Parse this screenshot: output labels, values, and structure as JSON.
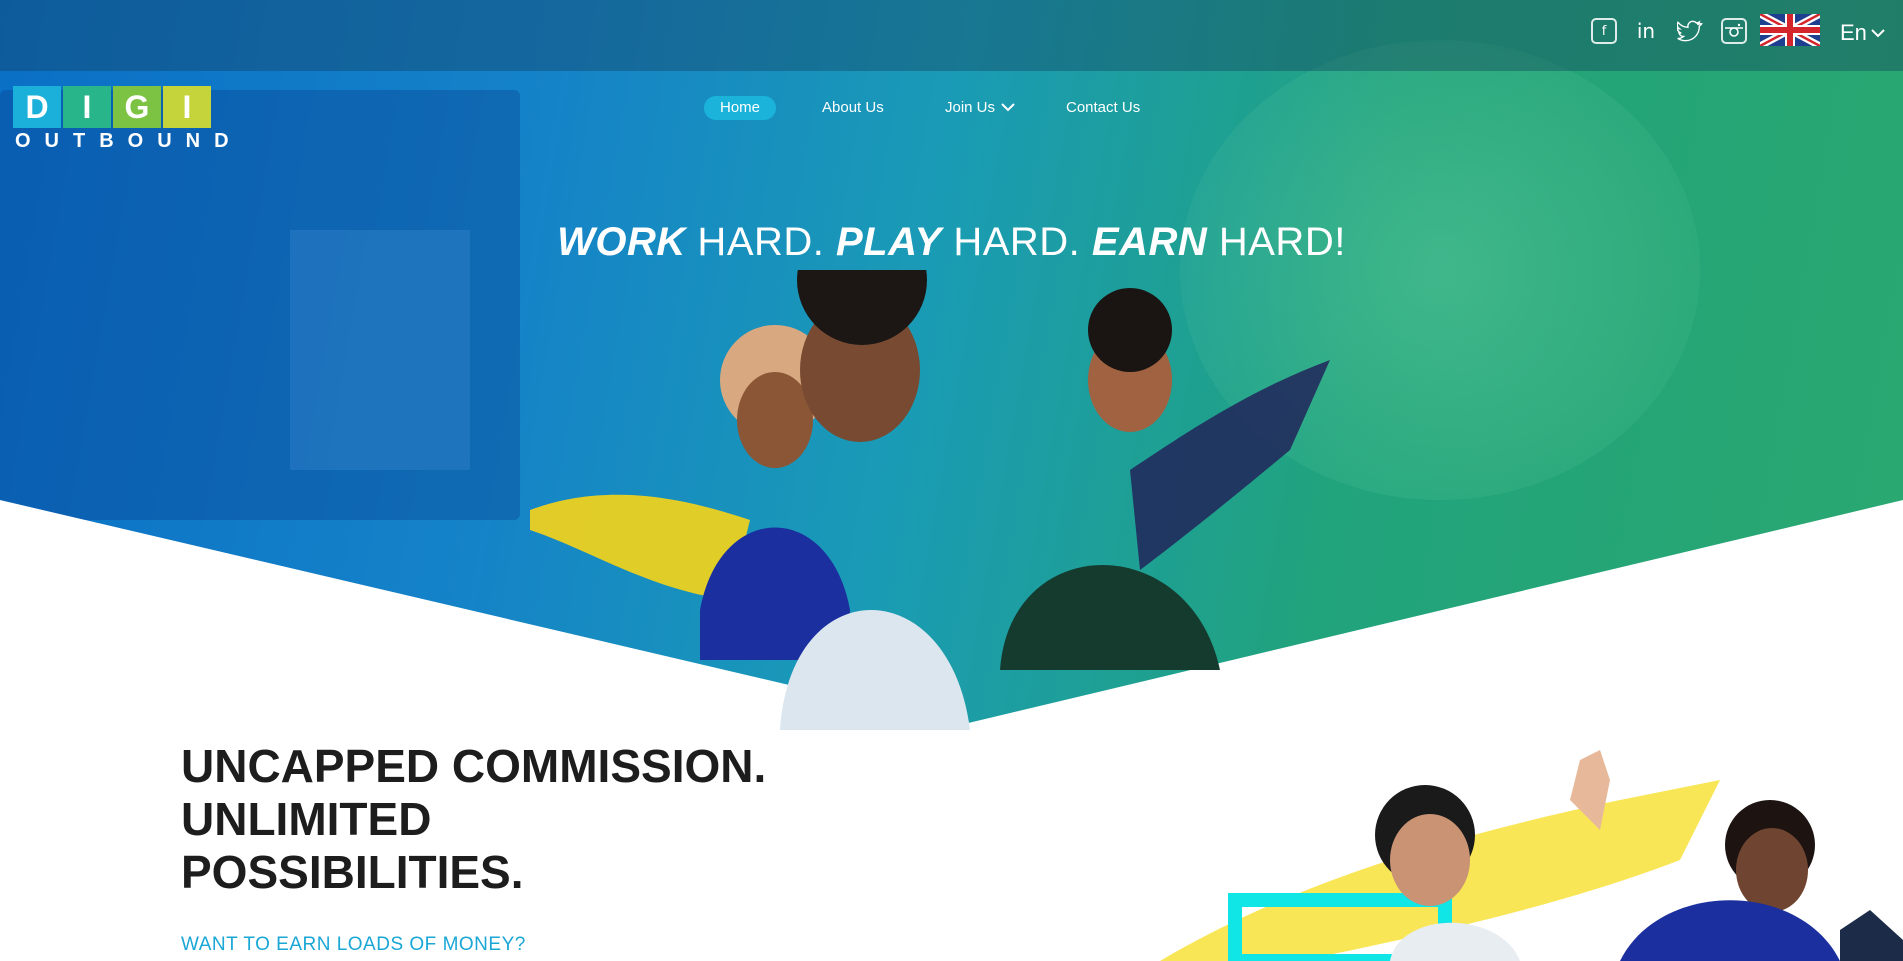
{
  "brand": {
    "logo_letters": [
      "D",
      "I",
      "G",
      "I"
    ],
    "logo_colors": [
      "#1ab0d9",
      "#29b58a",
      "#7cc243",
      "#c5d43a"
    ],
    "logo_sub": "OUTBOUND"
  },
  "topbar": {
    "social": [
      {
        "icon": "facebook-icon",
        "glyph": "f"
      },
      {
        "icon": "linkedin-icon",
        "glyph": "in"
      },
      {
        "icon": "twitter-icon",
        "glyph": "🐦"
      },
      {
        "icon": "instagram-icon",
        "glyph": "◎"
      }
    ],
    "language_flag": "uk-flag-icon",
    "language": "En"
  },
  "nav": {
    "items": [
      {
        "label": "Home",
        "active": true
      },
      {
        "label": "About Us",
        "active": false
      },
      {
        "label": "Join Us",
        "active": false,
        "has_dropdown": true
      },
      {
        "label": "Contact Us",
        "active": false
      }
    ]
  },
  "hero": {
    "headline": [
      {
        "bold": "WORK",
        "light": " HARD. "
      },
      {
        "bold": "PLAY",
        "light": " HARD. "
      },
      {
        "bold": "EARN",
        "light": " HARD!"
      }
    ]
  },
  "section": {
    "title_lines": [
      "UNCAPPED COMMISSION.",
      "UNLIMITED",
      "POSSIBILITIES."
    ],
    "subtitle": "WANT TO EARN LOADS OF MONEY?"
  },
  "colors": {
    "accent": "#1bb3d9",
    "hero_blue": "#0a6fc6",
    "hero_green": "#2aa870",
    "title_text": "#1d1d1d",
    "subtitle_text": "#1aa7d6"
  }
}
